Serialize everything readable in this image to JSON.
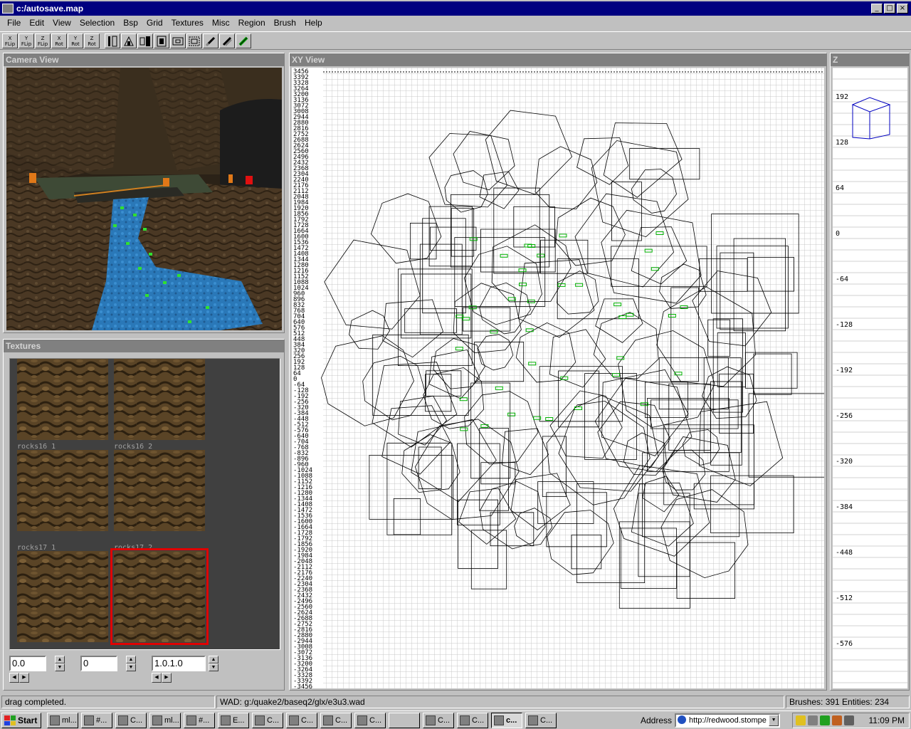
{
  "window": {
    "title": "c:/autosave.map"
  },
  "menu": [
    "File",
    "Edit",
    "View",
    "Selection",
    "Bsp",
    "Grid",
    "Textures",
    "Misc",
    "Region",
    "Brush",
    "Help"
  ],
  "toolbar": {
    "tools": [
      {
        "top": "X",
        "bottom": "FLip"
      },
      {
        "top": "Y",
        "bottom": "FLip"
      },
      {
        "top": "Z",
        "bottom": "FLip"
      },
      {
        "top": "X",
        "bottom": "Rot"
      },
      {
        "top": "Y",
        "bottom": "Rot"
      },
      {
        "top": "Z",
        "bottom": "Rot"
      }
    ]
  },
  "camera": {
    "title": "Camera View"
  },
  "textures": {
    "title": "Textures",
    "items": [
      {
        "label": ""
      },
      {
        "label": ""
      },
      {
        "label": "rocks16_1"
      },
      {
        "label": "rocks16_2"
      },
      {
        "label": "rocks17_1"
      },
      {
        "label": "rocks17_2"
      }
    ],
    "field1": "0.0",
    "field2": "0",
    "field3": "1.0.1.0"
  },
  "xy": {
    "title": "XY View",
    "y_labels": [
      "3456",
      "3392",
      "3328",
      "3264",
      "3200",
      "3136",
      "3072",
      "3008",
      "2944",
      "2880",
      "2816",
      "2752",
      "2688",
      "2624",
      "2560",
      "2496",
      "2432",
      "2368",
      "2304",
      "2240",
      "2176",
      "2112",
      "2048",
      "1984",
      "1920",
      "1856",
      "1792",
      "1728",
      "1664",
      "1600",
      "1536",
      "1472",
      "1408",
      "1344",
      "1280",
      "1216",
      "1152",
      "1088",
      "1024",
      "960",
      "896",
      "832",
      "768",
      "704",
      "640",
      "576",
      "512",
      "448",
      "384",
      "320",
      "256",
      "192",
      "128",
      "64",
      "0",
      "-64",
      "-128",
      "-192",
      "-256",
      "-320",
      "-384",
      "-448",
      "-512",
      "-576",
      "-640",
      "-704",
      "-768",
      "-832",
      "-896",
      "-960",
      "-1024",
      "-1088",
      "-1152",
      "-1216",
      "-1280",
      "-1344",
      "-1408",
      "-1472",
      "-1536",
      "-1600",
      "-1664",
      "-1728",
      "-1792",
      "-1856",
      "-1920",
      "-1984",
      "-2048",
      "-2112",
      "-2176",
      "-2240",
      "-2304",
      "-2368",
      "-2432",
      "-2496",
      "-2560",
      "-2624",
      "-2688",
      "-2752",
      "-2816",
      "-2880",
      "-2944",
      "-3008",
      "-3072",
      "-3136",
      "-3200",
      "-3264",
      "-3328",
      "-3392",
      "-3456"
    ]
  },
  "z": {
    "title": "Z",
    "labels": [
      "192",
      "128",
      "64",
      "0",
      "-64",
      "-128",
      "-192",
      "-256",
      "-320",
      "-384",
      "-448",
      "-512",
      "-576"
    ]
  },
  "status": {
    "message": "drag completed.",
    "wad": "WAD: g:/quake2/baseq2/glx/e3u3.wad",
    "counts": "Brushes: 391 Entities: 234"
  },
  "taskbar": {
    "start": "Start",
    "tasks": [
      "ml...",
      "#...",
      "C...",
      "ml...",
      "#...",
      "E...",
      "C...",
      "C...",
      "C...",
      "C...",
      "",
      "C...",
      "C...",
      "c...",
      "C..."
    ],
    "address_label": "Address",
    "address_value": "http://redwood.stompe",
    "clock": "11:09 PM"
  },
  "colors": {
    "titlebar": "#000080",
    "selected_texture": "#e00000",
    "entity_green": "#00c000",
    "water": "#2a78b8"
  }
}
